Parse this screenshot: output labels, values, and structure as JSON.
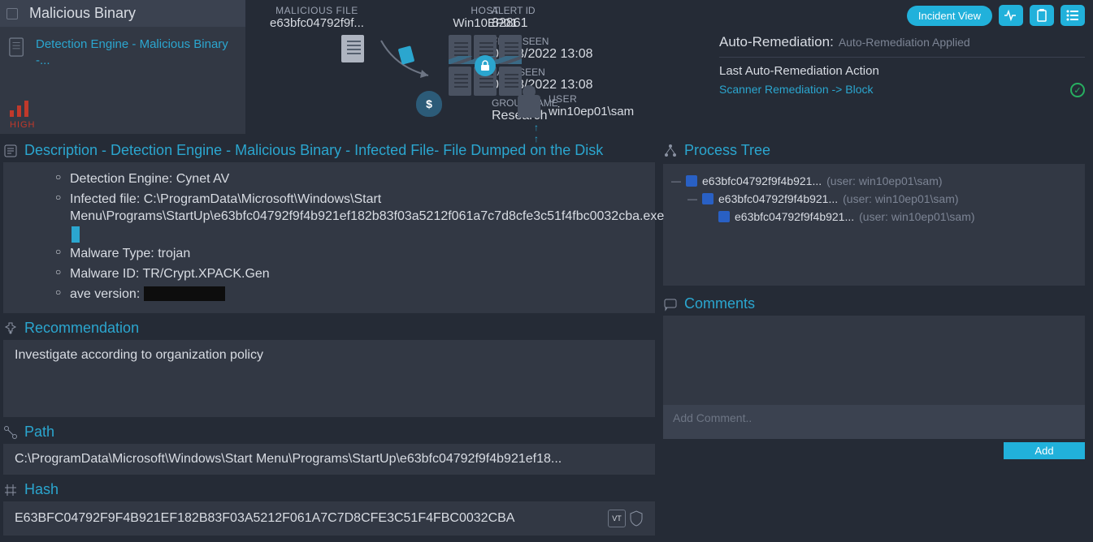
{
  "left_nav": {
    "title": "Malicious Binary",
    "item": "Detection Engine - Malicious Binary -...",
    "severity": "HIGH"
  },
  "diagram": {
    "file_label": "MALICIOUS FILE",
    "file_value": "e63bfc04792f9f...",
    "host_label": "HOST",
    "host_value": "Win10EP01",
    "user_label": "USER",
    "user_value": "win10ep01\\sam",
    "arrows": "↑ ↑ ↑"
  },
  "meta": {
    "alert_id_label": "ALERT ID",
    "alert_id": "82861",
    "first_seen_label": "FIRST SEEN",
    "first_seen": "07/03/2022 13:08",
    "last_seen_label": "LAST SEEN",
    "last_seen": "07/03/2022 13:08",
    "group_label": "GROUP NAME",
    "group": "Research",
    "incident_view": "Incident View",
    "auto_rem_label": "Auto-Remediation:",
    "auto_rem_value": "Auto-Remediation Applied",
    "last_action_label": "Last Auto-Remediation Action",
    "last_action_link": "Scanner Remediation -> Block"
  },
  "description": {
    "title": "Description - Detection Engine - Malicious Binary - Infected File- File Dumped on the Disk",
    "items": [
      "Detection Engine: Cynet AV",
      "Infected file: C:\\ProgramData\\Microsoft\\Windows\\Start Menu\\Programs\\StartUp\\e63bfc04792f9f4b921ef182b83f03a5212f061a7c7d8cfe3c51f4fbc0032cba.exe",
      "Malware Type: trojan",
      "Malware ID: TR/Crypt.XPACK.Gen",
      "ave version: "
    ]
  },
  "recommendation": {
    "title": "Recommendation",
    "text": "Investigate according to organization policy"
  },
  "path": {
    "title": "Path",
    "value": "C:\\ProgramData\\Microsoft\\Windows\\Start Menu\\Programs\\StartUp\\e63bfc04792f9f4b921ef18..."
  },
  "hash": {
    "title": "Hash",
    "value": "E63BFC04792F9F4B921EF182B83F03A5212F061A7C7D8CFE3C51F4FBC0032CBA"
  },
  "process_tree": {
    "title": "Process Tree",
    "nodes": [
      {
        "name": "e63bfc04792f9f4b921...",
        "user": "(user: win10ep01\\sam)",
        "indent": 0,
        "collapsible": true
      },
      {
        "name": "e63bfc04792f9f4b921...",
        "user": "(user: win10ep01\\sam)",
        "indent": 1,
        "collapsible": true
      },
      {
        "name": "e63bfc04792f9f4b921...",
        "user": "(user: win10ep01\\sam)",
        "indent": 2,
        "collapsible": false
      }
    ]
  },
  "comments": {
    "title": "Comments",
    "placeholder": "Add Comment..",
    "add_label": "Add"
  }
}
